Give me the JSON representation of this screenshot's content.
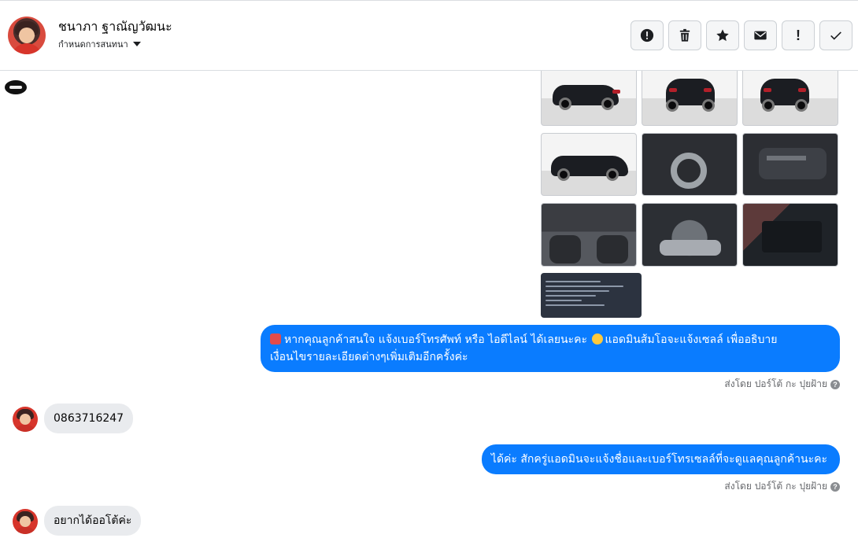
{
  "header": {
    "contact_name": "ชนาภา ฐาณัญวัฒนะ",
    "assign_label": "กำหนดการสนทนา",
    "actions": [
      {
        "id": "spam",
        "icon": "exclamation-circle-icon"
      },
      {
        "id": "delete",
        "icon": "trash-icon"
      },
      {
        "id": "star",
        "icon": "star-icon"
      },
      {
        "id": "unread",
        "icon": "envelope-icon"
      },
      {
        "id": "priority",
        "icon": "exclamation-icon",
        "glyph": "!"
      },
      {
        "id": "done",
        "icon": "check-icon"
      }
    ]
  },
  "photos": [
    {
      "name": "car-rear-left",
      "icon": "car-photo"
    },
    {
      "name": "car-rear",
      "icon": "car-photo"
    },
    {
      "name": "car-rear-right",
      "icon": "car-photo"
    },
    {
      "name": "car-side",
      "icon": "car-photo"
    },
    {
      "name": "car-wheel",
      "icon": "car-photo"
    },
    {
      "name": "car-door-panel",
      "icon": "car-photo"
    },
    {
      "name": "car-interior",
      "icon": "car-photo"
    },
    {
      "name": "car-engine",
      "icon": "car-photo"
    },
    {
      "name": "car-battery",
      "icon": "car-photo"
    },
    {
      "name": "car-spec-sheet",
      "icon": "document-photo"
    }
  ],
  "messages": [
    {
      "direction": "out",
      "text_lines": [
        "หากคุณลูกค้าสนใจ แจ้งเบอร์โทรศัพท์ หรือ ไอดีไลน์  ได้เลยนะคะ",
        "แอดมินส้มโอจะแจ้งเซลล์  เพื่ออธิบาย",
        "เงื่อนไขรายละเอียดต่างๆเพิ่มเติมอีกครั้งค่ะ"
      ]
    },
    {
      "sent_by": "ส่งโดย ปอร์โต้ กะ ปุยฝ้าย"
    },
    {
      "direction": "in",
      "text": "0863716247"
    },
    {
      "direction": "out",
      "text": "ได้ค่ะ สักครู่แอดมินจะแจ้งชื่อและเบอร์โทรเซลล์ที่จะดูแลคุณลูกค้านะคะ"
    },
    {
      "sent_by": "ส่งโดย ปอร์โต้ กะ ปุยฝ้าย"
    },
    {
      "direction": "in",
      "text": "อยากได้ออโต้ค่ะ"
    }
  ],
  "colors": {
    "outgoing_bubble": "#0a7cff",
    "incoming_bubble": "#e9ebee",
    "border": "#dadde1"
  }
}
